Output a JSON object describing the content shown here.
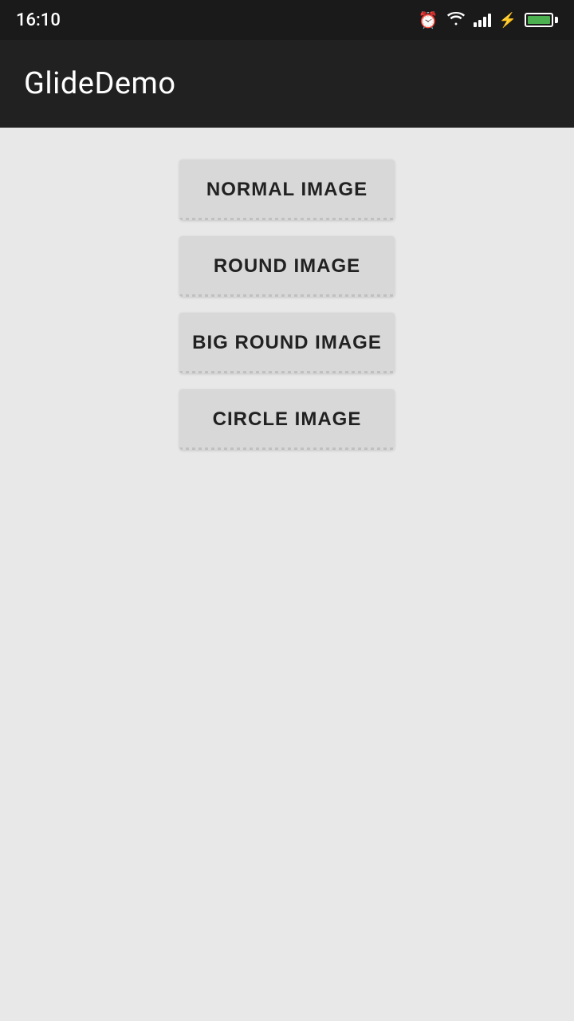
{
  "statusBar": {
    "time": "16:10"
  },
  "appBar": {
    "title": "GlideDemo"
  },
  "buttons": [
    {
      "id": "normal-image-button",
      "label": "NORMAL IMAGE"
    },
    {
      "id": "round-image-button",
      "label": "ROUND IMAGE"
    },
    {
      "id": "big-round-image-button",
      "label": "BIG ROUND IMAGE"
    },
    {
      "id": "circle-image-button",
      "label": "CIRCLE IMAGE"
    }
  ]
}
